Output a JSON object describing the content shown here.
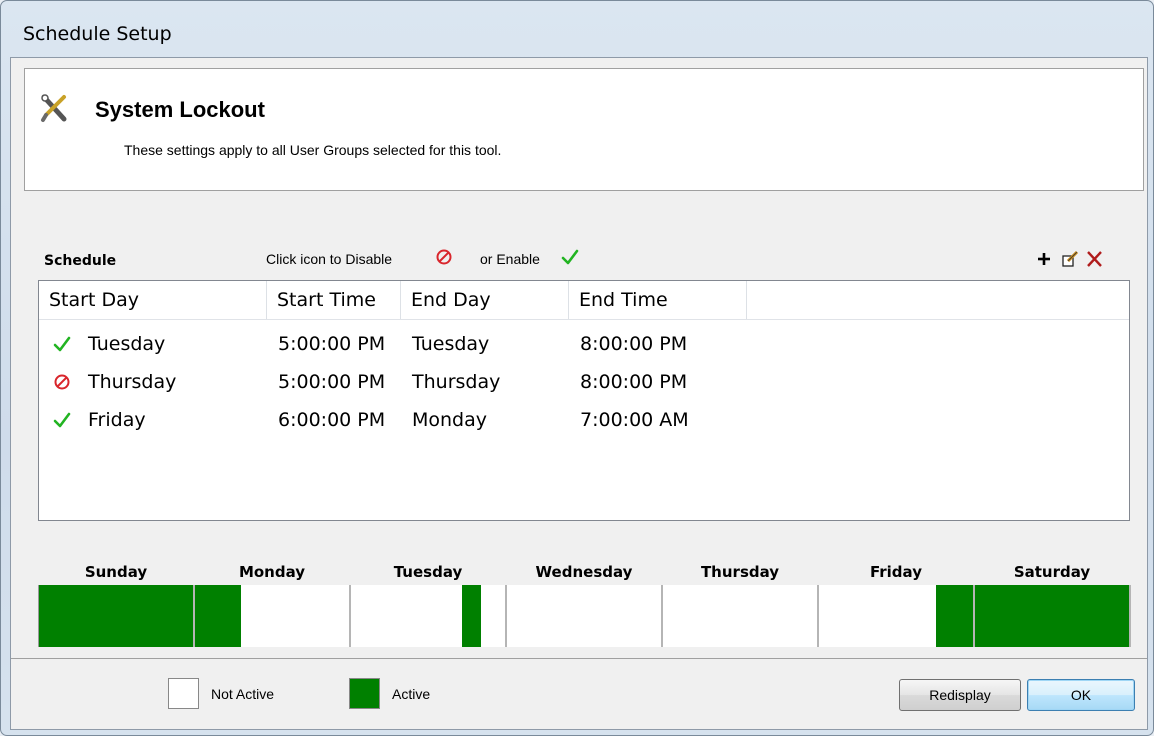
{
  "window": {
    "title": "Schedule Setup"
  },
  "header": {
    "title": "System Lockout",
    "subtitle": "These settings apply to all User Groups selected for this tool."
  },
  "schedule": {
    "label": "Schedule",
    "hint_disable": "Click icon to Disable",
    "hint_enable": "or Enable",
    "columns": [
      "Start Day",
      "Start Time",
      "End Day",
      "End Time"
    ],
    "rows": [
      {
        "status": "enabled",
        "start_day": "Tuesday",
        "start_time": "5:00:00 PM",
        "end_day": "Tuesday",
        "end_time": "8:00:00 PM"
      },
      {
        "status": "disabled",
        "start_day": "Thursday",
        "start_time": "5:00:00 PM",
        "end_day": "Thursday",
        "end_time": "8:00:00 PM"
      },
      {
        "status": "enabled",
        "start_day": "Friday",
        "start_time": "6:00:00 PM",
        "end_day": "Monday",
        "end_time": "7:00:00 AM"
      }
    ]
  },
  "week": {
    "days": [
      "Sunday",
      "Monday",
      "Tuesday",
      "Wednesday",
      "Thursday",
      "Friday",
      "Saturday"
    ],
    "active_hours": [
      {
        "day": "Sunday",
        "from": 0,
        "to": 24
      },
      {
        "day": "Monday",
        "from": 0,
        "to": 7
      },
      {
        "day": "Tuesday",
        "from": 17,
        "to": 20
      },
      {
        "day": "Friday",
        "from": 18,
        "to": 24
      },
      {
        "day": "Saturday",
        "from": 0,
        "to": 24
      }
    ],
    "active_color": "#008000",
    "inactive_color": "#ffffff"
  },
  "legend": {
    "not_active": "Not Active",
    "active": "Active"
  },
  "buttons": {
    "redisplay": "Redisplay",
    "ok": "OK"
  },
  "colors": {
    "enabled_check": "#22b422",
    "disabled_mark": "#d9262c",
    "delete": "#b01c1c"
  }
}
